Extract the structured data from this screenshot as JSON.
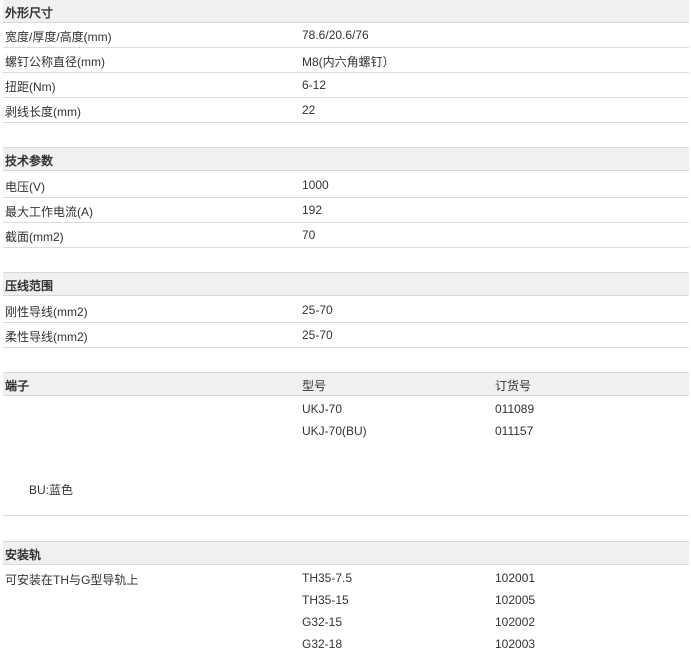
{
  "dimensions": {
    "title": "外形尺寸",
    "rows": [
      {
        "label": "宽度/厚度/高度(mm)",
        "value": "78.6/20.6/76"
      },
      {
        "label": "螺钉公称直径(mm)",
        "value": "M8(内六角螺钉）"
      },
      {
        "label": "扭距(Nm)",
        "value": "6-12"
      },
      {
        "label": "剥线长度(mm)",
        "value": "22"
      }
    ]
  },
  "technical": {
    "title": "技术参数",
    "rows": [
      {
        "label": "电压(V)",
        "value": "1000"
      },
      {
        "label": "最大工作电流(A)",
        "value": "192"
      },
      {
        "label": "截面(mm2)",
        "value": "70"
      }
    ]
  },
  "crimp": {
    "title": "压线范围",
    "rows": [
      {
        "label": "刚性导线(mm2)",
        "value": "25-70"
      },
      {
        "label": "柔性导线(mm2)",
        "value": "25-70"
      }
    ]
  },
  "terminal": {
    "title": "端子",
    "col_model": "型号",
    "col_order": "订货号",
    "rows": [
      {
        "model": "UKJ-70",
        "order": "011089"
      },
      {
        "model": "UKJ-70(BU)",
        "order": "011157"
      }
    ],
    "note": "BU:蓝色"
  },
  "rail": {
    "title": "安装轨",
    "label": "可安装在TH与G型导轨上",
    "rows": [
      {
        "model": "TH35-7.5",
        "order": "102001"
      },
      {
        "model": "TH35-15",
        "order": "102005"
      },
      {
        "model": "G32-15",
        "order": "102002"
      },
      {
        "model": "G32-18",
        "order": "102003"
      }
    ]
  }
}
